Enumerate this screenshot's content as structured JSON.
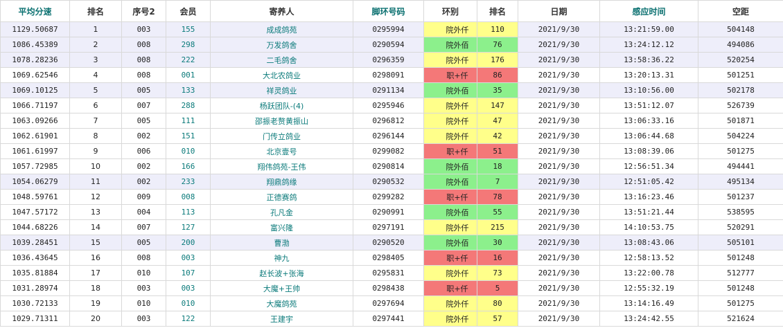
{
  "headers": {
    "speed": "平均分速",
    "rank": "排名",
    "seq": "序号2",
    "member": "会员",
    "owner": "寄养人",
    "ring": "脚环号码",
    "zone": "环别",
    "group_rank": "排名",
    "date": "日期",
    "time": "感应时间",
    "distance": "空距"
  },
  "colors": {
    "yellow": "#ffff8a",
    "green": "#8cf08c",
    "red": "#f47878",
    "teal": "#0a7070",
    "band": "#eeeefa"
  },
  "rows": [
    {
      "speed": "1129.50687",
      "rank": "1",
      "seq": "003",
      "member": "155",
      "owner": "成成鸽苑",
      "ring": "0295994",
      "zone": "院外仟",
      "zone_color": "yellow",
      "group_rank": "110",
      "date": "2021/9/30",
      "time": "13:21:59.00",
      "distance": "504148"
    },
    {
      "speed": "1086.45389",
      "rank": "2",
      "seq": "008",
      "member": "298",
      "owner": "万发鸽舍",
      "ring": "0290594",
      "zone": "院外佰",
      "zone_color": "green",
      "group_rank": "76",
      "date": "2021/9/30",
      "time": "13:24:12.12",
      "distance": "494086"
    },
    {
      "speed": "1078.28236",
      "rank": "3",
      "seq": "008",
      "member": "222",
      "owner": "二毛鸽舍",
      "ring": "0296359",
      "zone": "院外仟",
      "zone_color": "yellow",
      "group_rank": "176",
      "date": "2021/9/30",
      "time": "13:58:36.22",
      "distance": "520254"
    },
    {
      "speed": "1069.62546",
      "rank": "4",
      "seq": "008",
      "member": "001",
      "owner": "大北农鸽业",
      "ring": "0298091",
      "zone": "职+仟",
      "zone_color": "red",
      "group_rank": "86",
      "date": "2021/9/30",
      "time": "13:20:13.31",
      "distance": "501251"
    },
    {
      "speed": "1069.10125",
      "rank": "5",
      "seq": "005",
      "member": "133",
      "owner": "祥灵鸽业",
      "ring": "0291134",
      "zone": "院外佰",
      "zone_color": "green",
      "group_rank": "35",
      "date": "2021/9/30",
      "time": "13:10:56.00",
      "distance": "502178"
    },
    {
      "speed": "1066.71197",
      "rank": "6",
      "seq": "007",
      "member": "288",
      "owner": "杨跃团队-(4)",
      "ring": "0295946",
      "zone": "院外仟",
      "zone_color": "yellow",
      "group_rank": "147",
      "date": "2021/9/30",
      "time": "13:51:12.07",
      "distance": "526739"
    },
    {
      "speed": "1063.09266",
      "rank": "7",
      "seq": "005",
      "member": "111",
      "owner": "邵振老赘黄振山",
      "ring": "0296812",
      "zone": "院外仟",
      "zone_color": "yellow",
      "group_rank": "47",
      "date": "2021/9/30",
      "time": "13:06:33.16",
      "distance": "501871"
    },
    {
      "speed": "1062.61901",
      "rank": "8",
      "seq": "002",
      "member": "151",
      "owner": "门传立鸽业",
      "ring": "0296144",
      "zone": "院外仟",
      "zone_color": "yellow",
      "group_rank": "42",
      "date": "2021/9/30",
      "time": "13:06:44.68",
      "distance": "504224"
    },
    {
      "speed": "1061.61997",
      "rank": "9",
      "seq": "006",
      "member": "010",
      "owner": "北京壹号",
      "ring": "0299082",
      "zone": "职+仟",
      "zone_color": "red",
      "group_rank": "51",
      "date": "2021/9/30",
      "time": "13:08:39.06",
      "distance": "501275"
    },
    {
      "speed": "1057.72985",
      "rank": "10",
      "seq": "002",
      "member": "166",
      "owner": "翔伟鸽苑-王伟",
      "ring": "0290814",
      "zone": "院外佰",
      "zone_color": "green",
      "group_rank": "18",
      "date": "2021/9/30",
      "time": "12:56:51.34",
      "distance": "494441"
    },
    {
      "speed": "1054.06279",
      "rank": "11",
      "seq": "002",
      "member": "233",
      "owner": "翔鼎鸽缘",
      "ring": "0290532",
      "zone": "院外佰",
      "zone_color": "green",
      "group_rank": "7",
      "date": "2021/9/30",
      "time": "12:51:05.42",
      "distance": "495134"
    },
    {
      "speed": "1048.59761",
      "rank": "12",
      "seq": "009",
      "member": "008",
      "owner": "正德赛鸽",
      "ring": "0299282",
      "zone": "职+仟",
      "zone_color": "red",
      "group_rank": "78",
      "date": "2021/9/30",
      "time": "13:16:23.46",
      "distance": "501237"
    },
    {
      "speed": "1047.57172",
      "rank": "13",
      "seq": "004",
      "member": "113",
      "owner": "孔凡金",
      "ring": "0290991",
      "zone": "院外佰",
      "zone_color": "green",
      "group_rank": "55",
      "date": "2021/9/30",
      "time": "13:51:21.44",
      "distance": "538595"
    },
    {
      "speed": "1044.68226",
      "rank": "14",
      "seq": "007",
      "member": "127",
      "owner": "富兴隆",
      "ring": "0297191",
      "zone": "院外仟",
      "zone_color": "yellow",
      "group_rank": "215",
      "date": "2021/9/30",
      "time": "14:10:53.75",
      "distance": "520291"
    },
    {
      "speed": "1039.28451",
      "rank": "15",
      "seq": "005",
      "member": "200",
      "owner": "曹渤",
      "ring": "0290520",
      "zone": "院外佰",
      "zone_color": "green",
      "group_rank": "30",
      "date": "2021/9/30",
      "time": "13:08:43.06",
      "distance": "505101"
    },
    {
      "speed": "1036.43645",
      "rank": "16",
      "seq": "008",
      "member": "003",
      "owner": "神九",
      "ring": "0298405",
      "zone": "职+仟",
      "zone_color": "red",
      "group_rank": "16",
      "date": "2021/9/30",
      "time": "12:58:13.52",
      "distance": "501248"
    },
    {
      "speed": "1035.81884",
      "rank": "17",
      "seq": "010",
      "member": "107",
      "owner": "赵长波+张海",
      "ring": "0295831",
      "zone": "院外仟",
      "zone_color": "yellow",
      "group_rank": "73",
      "date": "2021/9/30",
      "time": "13:22:00.78",
      "distance": "512777"
    },
    {
      "speed": "1031.28974",
      "rank": "18",
      "seq": "003",
      "member": "003",
      "owner": "大魔+王帅",
      "ring": "0298438",
      "zone": "职+仟",
      "zone_color": "red",
      "group_rank": "5",
      "date": "2021/9/30",
      "time": "12:55:32.19",
      "distance": "501248"
    },
    {
      "speed": "1030.72133",
      "rank": "19",
      "seq": "010",
      "member": "010",
      "owner": "大魔鸽苑",
      "ring": "0297694",
      "zone": "院外仟",
      "zone_color": "yellow",
      "group_rank": "80",
      "date": "2021/9/30",
      "time": "13:14:16.49",
      "distance": "501275"
    },
    {
      "speed": "1029.71311",
      "rank": "20",
      "seq": "003",
      "member": "122",
      "owner": "王建宇",
      "ring": "0297441",
      "zone": "院外仟",
      "zone_color": "yellow",
      "group_rank": "57",
      "date": "2021/9/30",
      "time": "13:24:42.55",
      "distance": "521624"
    }
  ]
}
